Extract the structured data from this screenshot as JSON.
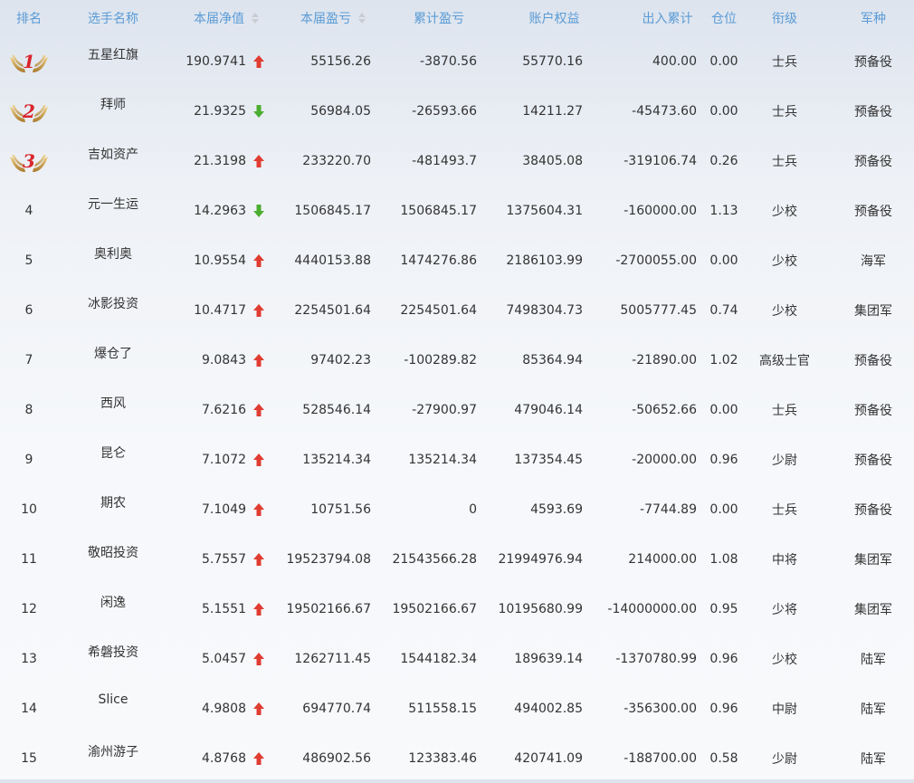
{
  "colors": {
    "header_text": "#5b9bd5",
    "up_arrow": "#e03c31",
    "down_arrow": "#4bae30",
    "medal_wing": "#c89b3c",
    "medal_number": "#d9262c"
  },
  "header": {
    "rank": "排名",
    "name": "选手名称",
    "nav": "本届净值",
    "pl": "本届盈亏",
    "cum": "累计盈亏",
    "equity": "账户权益",
    "io": "出入累计",
    "position": "仓位",
    "grade": "衔级",
    "arm": "军种"
  },
  "rows": [
    {
      "rank": "1",
      "name": "五星红旗",
      "nav": "190.9741",
      "trend": "up",
      "pl": "55156.26",
      "cum": "-3870.56",
      "equity": "55770.16",
      "io": "400.00",
      "position": "0.00",
      "grade": "士兵",
      "arm": "预备役"
    },
    {
      "rank": "2",
      "name": "拜师",
      "nav": "21.9325",
      "trend": "down",
      "pl": "56984.05",
      "cum": "-26593.66",
      "equity": "14211.27",
      "io": "-45473.60",
      "position": "0.00",
      "grade": "士兵",
      "arm": "预备役"
    },
    {
      "rank": "3",
      "name": "吉如资产",
      "nav": "21.3198",
      "trend": "up",
      "pl": "233220.70",
      "cum": "-481493.7",
      "equity": "38405.08",
      "io": "-319106.74",
      "position": "0.26",
      "grade": "士兵",
      "arm": "预备役"
    },
    {
      "rank": "4",
      "name": "元一生运",
      "nav": "14.2963",
      "trend": "down",
      "pl": "1506845.17",
      "cum": "1506845.17",
      "equity": "1375604.31",
      "io": "-160000.00",
      "position": "1.13",
      "grade": "少校",
      "arm": "预备役"
    },
    {
      "rank": "5",
      "name": "奥利奥",
      "nav": "10.9554",
      "trend": "up",
      "pl": "4440153.88",
      "cum": "1474276.86",
      "equity": "2186103.99",
      "io": "-2700055.00",
      "position": "0.00",
      "grade": "少校",
      "arm": "海军"
    },
    {
      "rank": "6",
      "name": "冰影投资",
      "nav": "10.4717",
      "trend": "up",
      "pl": "2254501.64",
      "cum": "2254501.64",
      "equity": "7498304.73",
      "io": "5005777.45",
      "position": "0.74",
      "grade": "少校",
      "arm": "集团军"
    },
    {
      "rank": "7",
      "name": "爆仓了",
      "nav": "9.0843",
      "trend": "up",
      "pl": "97402.23",
      "cum": "-100289.82",
      "equity": "85364.94",
      "io": "-21890.00",
      "position": "1.02",
      "grade": "高级士官",
      "arm": "预备役"
    },
    {
      "rank": "8",
      "name": "西风",
      "nav": "7.6216",
      "trend": "up",
      "pl": "528546.14",
      "cum": "-27900.97",
      "equity": "479046.14",
      "io": "-50652.66",
      "position": "0.00",
      "grade": "士兵",
      "arm": "预备役"
    },
    {
      "rank": "9",
      "name": "昆仑",
      "nav": "7.1072",
      "trend": "up",
      "pl": "135214.34",
      "cum": "135214.34",
      "equity": "137354.45",
      "io": "-20000.00",
      "position": "0.96",
      "grade": "少尉",
      "arm": "预备役"
    },
    {
      "rank": "10",
      "name": "期农",
      "nav": "7.1049",
      "trend": "up",
      "pl": "10751.56",
      "cum": "0",
      "equity": "4593.69",
      "io": "-7744.89",
      "position": "0.00",
      "grade": "士兵",
      "arm": "预备役"
    },
    {
      "rank": "11",
      "name": "敬昭投资",
      "nav": "5.7557",
      "trend": "up",
      "pl": "19523794.08",
      "cum": "21543566.28",
      "equity": "21994976.94",
      "io": "214000.00",
      "position": "1.08",
      "grade": "中将",
      "arm": "集团军"
    },
    {
      "rank": "12",
      "name": "闲逸",
      "nav": "5.1551",
      "trend": "up",
      "pl": "19502166.67",
      "cum": "19502166.67",
      "equity": "10195680.99",
      "io": "-14000000.00",
      "position": "0.95",
      "grade": "少将",
      "arm": "集团军"
    },
    {
      "rank": "13",
      "name": "希磐投资",
      "nav": "5.0457",
      "trend": "up",
      "pl": "1262711.45",
      "cum": "1544182.34",
      "equity": "189639.14",
      "io": "-1370780.99",
      "position": "0.96",
      "grade": "少校",
      "arm": "陆军"
    },
    {
      "rank": "14",
      "name": "Slice",
      "nav": "4.9808",
      "trend": "up",
      "pl": "694770.74",
      "cum": "511558.15",
      "equity": "494002.85",
      "io": "-356300.00",
      "position": "0.96",
      "grade": "中尉",
      "arm": "陆军"
    },
    {
      "rank": "15",
      "name": "渝州游子",
      "nav": "4.8768",
      "trend": "up",
      "pl": "486902.56",
      "cum": "123383.46",
      "equity": "420741.09",
      "io": "-188700.00",
      "position": "0.58",
      "grade": "少尉",
      "arm": "陆军"
    }
  ]
}
